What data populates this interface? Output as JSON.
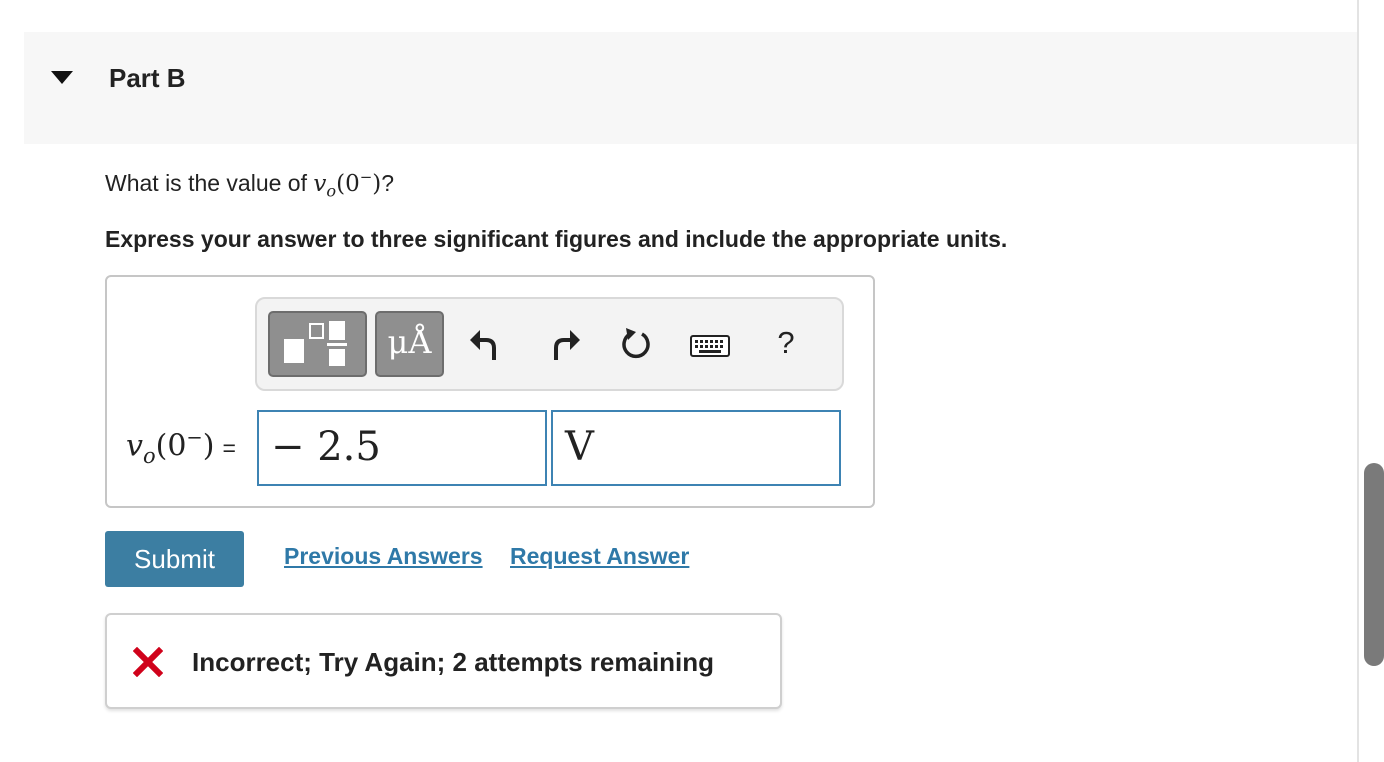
{
  "part": {
    "title": "Part B"
  },
  "question": {
    "prefix": "What is the value of ",
    "variable": "v",
    "subscript": "o",
    "argument": "0",
    "superscript": "−",
    "suffix": "?",
    "instruction": "Express your answer to three significant figures and include the appropriate units."
  },
  "toolbar": {
    "templates_icon": "templates-icon",
    "units_label": "μÅ",
    "undo_icon": "undo-icon",
    "redo_icon": "redo-icon",
    "reset_icon": "reset-icon",
    "keyboard_icon": "keyboard-icon",
    "help_label": "?"
  },
  "answer": {
    "label_variable": "v",
    "label_subscript": "o",
    "label_argument": "0",
    "label_superscript": "−",
    "equals": "=",
    "value": "− 2.5",
    "units": "V"
  },
  "actions": {
    "submit_label": "Submit",
    "previous_answers_label": "Previous Answers",
    "request_answer_label": "Request Answer"
  },
  "feedback": {
    "icon": "x-icon",
    "text": "Incorrect; Try Again; 2 attempts remaining"
  },
  "colors": {
    "accent": "#3c7ea2",
    "link": "#2f79a8",
    "field_border": "#3d83b3",
    "error": "#d0021b"
  }
}
